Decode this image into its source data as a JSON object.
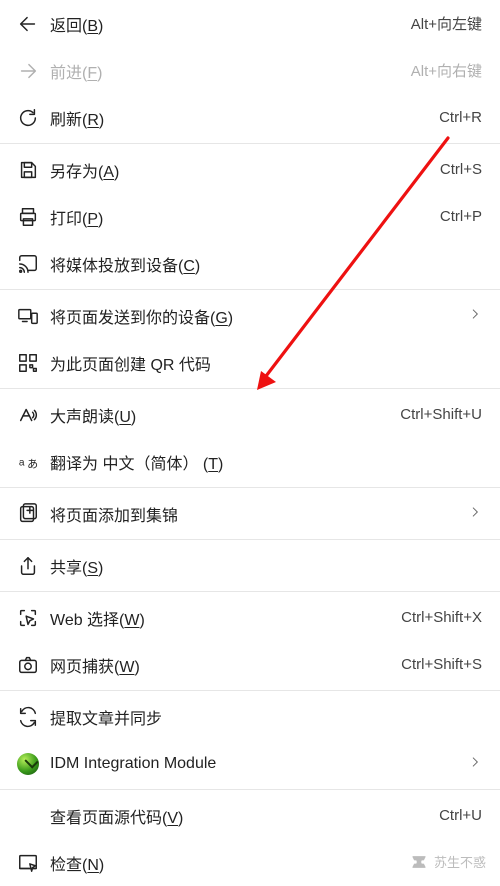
{
  "items": [
    {
      "id": "back",
      "label_pre": "返回(",
      "key": "B",
      "label_post": ")",
      "shortcut": "Alt+向左键",
      "icon": "arrow-left",
      "disabled": false,
      "chevron": false
    },
    {
      "id": "forward",
      "label_pre": "前进(",
      "key": "F",
      "label_post": ")",
      "shortcut": "Alt+向右键",
      "icon": "arrow-right",
      "disabled": true,
      "chevron": false
    },
    {
      "id": "refresh",
      "label_pre": "刷新(",
      "key": "R",
      "label_post": ")",
      "shortcut": "Ctrl+R",
      "icon": "refresh",
      "disabled": false,
      "chevron": false
    },
    {
      "sep": true
    },
    {
      "id": "save-as",
      "label_pre": "另存为(",
      "key": "A",
      "label_post": ")",
      "shortcut": "Ctrl+S",
      "icon": "save",
      "disabled": false,
      "chevron": false
    },
    {
      "id": "print",
      "label_pre": "打印(",
      "key": "P",
      "label_post": ")",
      "shortcut": "Ctrl+P",
      "icon": "print",
      "disabled": false,
      "chevron": false
    },
    {
      "id": "cast",
      "label_pre": "将媒体投放到设备(",
      "key": "C",
      "label_post": ")",
      "shortcut": "",
      "icon": "cast",
      "disabled": false,
      "chevron": false
    },
    {
      "sep": true
    },
    {
      "id": "send-device",
      "label_pre": "将页面发送到你的设备(",
      "key": "G",
      "label_post": ")",
      "shortcut": "",
      "icon": "devices",
      "disabled": false,
      "chevron": true
    },
    {
      "id": "qr-code",
      "label_pre": "为此页面创建 QR 代码",
      "key": "",
      "label_post": "",
      "shortcut": "",
      "icon": "qr",
      "disabled": false,
      "chevron": false
    },
    {
      "sep": true
    },
    {
      "id": "read-aloud",
      "label_pre": "大声朗读(",
      "key": "U",
      "label_post": ")",
      "shortcut": "Ctrl+Shift+U",
      "icon": "read-aloud",
      "disabled": false,
      "chevron": false
    },
    {
      "id": "translate",
      "label_pre": "翻译为 中文（简体） (",
      "key": "T",
      "label_post": ")",
      "shortcut": "",
      "icon": "translate",
      "disabled": false,
      "chevron": false
    },
    {
      "sep": true
    },
    {
      "id": "collections",
      "label_pre": "将页面添加到集锦",
      "key": "",
      "label_post": "",
      "shortcut": "",
      "icon": "collections",
      "disabled": false,
      "chevron": true
    },
    {
      "sep": true
    },
    {
      "id": "share",
      "label_pre": "共享(",
      "key": "S",
      "label_post": ")",
      "shortcut": "",
      "icon": "share",
      "disabled": false,
      "chevron": false
    },
    {
      "sep": true
    },
    {
      "id": "web-select",
      "label_pre": "Web 选择(",
      "key": "W",
      "label_post": ")",
      "shortcut": "Ctrl+Shift+X",
      "icon": "web-select",
      "disabled": false,
      "chevron": false
    },
    {
      "id": "web-capture",
      "label_pre": "网页捕获(",
      "key": "W",
      "label_post": ")",
      "shortcut": "Ctrl+Shift+S",
      "icon": "capture",
      "disabled": false,
      "chevron": false
    },
    {
      "sep": true
    },
    {
      "id": "sync-article",
      "label_pre": "提取文章并同步",
      "key": "",
      "label_post": "",
      "shortcut": "",
      "icon": "sync",
      "disabled": false,
      "chevron": false
    },
    {
      "id": "idm",
      "label_pre": "IDM Integration Module",
      "key": "",
      "label_post": "",
      "shortcut": "",
      "icon": "idm",
      "disabled": false,
      "chevron": true
    },
    {
      "sep": true
    },
    {
      "id": "view-source",
      "label_pre": "查看页面源代码(",
      "key": "V",
      "label_post": ")",
      "shortcut": "Ctrl+U",
      "icon": "",
      "disabled": false,
      "chevron": false
    },
    {
      "id": "inspect",
      "label_pre": "检查(",
      "key": "N",
      "label_post": ")",
      "shortcut": "",
      "icon": "inspect",
      "disabled": false,
      "chevron": false
    }
  ],
  "watermark": "苏生不惑",
  "arrow": {
    "note": "red annotation arrow pointing at Read Aloud item"
  }
}
